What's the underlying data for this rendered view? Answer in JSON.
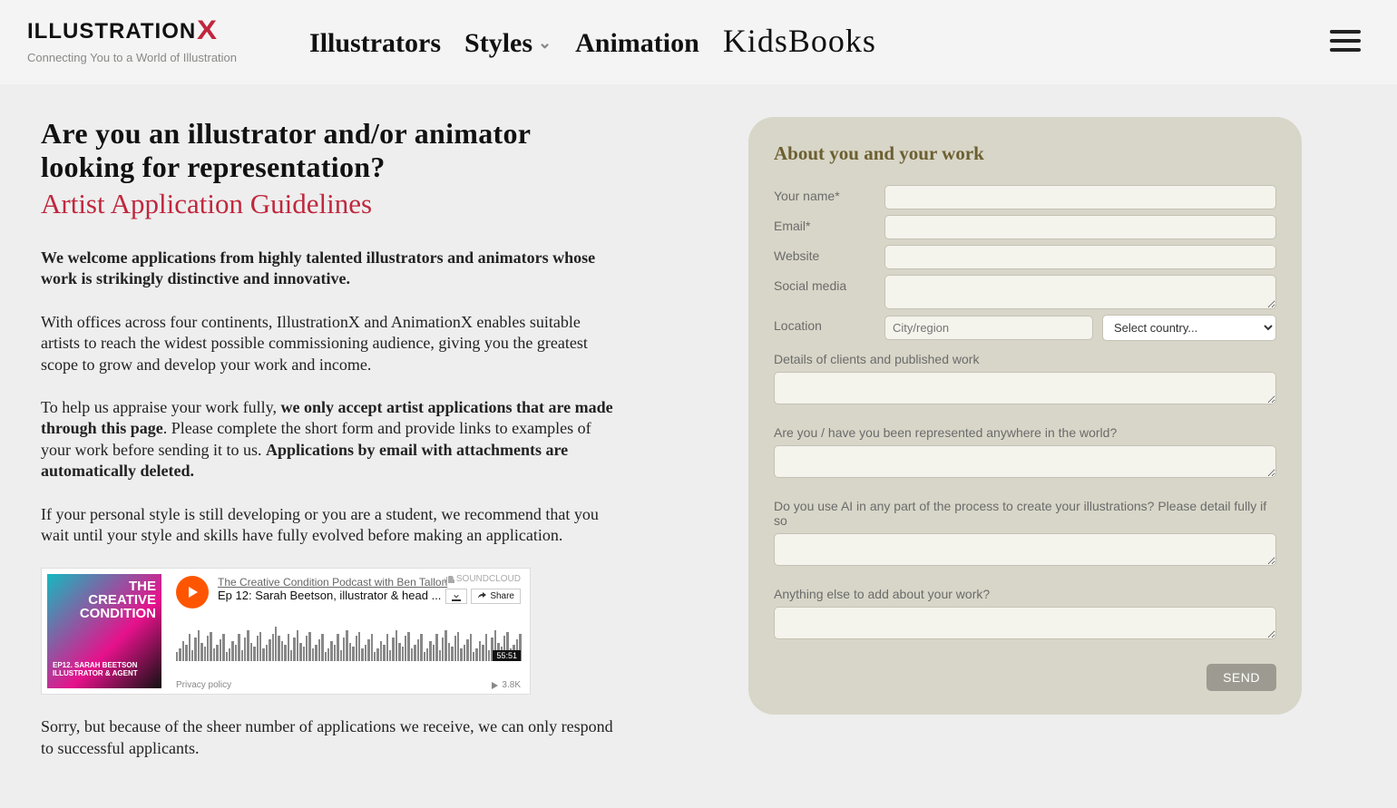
{
  "brand": {
    "name_part1": "ILLUSTRATION",
    "name_part2": "X",
    "tagline": "Connecting You to a World of Illustration"
  },
  "nav": {
    "illustrators": "Illustrators",
    "styles": "Styles",
    "animation": "Animation",
    "kidsbooks": "KidsBooks"
  },
  "headline": "Are you an illustrator and/or animator looking for representation?",
  "subhead": "Artist Application Guidelines",
  "paras": {
    "p1_bold": "We welcome applications from highly talented illustrators and animators whose work is strikingly distinctive and innovative.",
    "p2": "With offices across four continents, IllustrationX and AnimationX enables suitable artists to reach the widest possible commissioning audience, giving you the greatest scope to grow and develop your work and income.",
    "p3_a": "To help us appraise your work fully, ",
    "p3_b_bold": "we only accept artist applications that are made through this page",
    "p3_c": ". Please complete the short form and provide links to examples of your work before sending it to us. ",
    "p3_d_bold": "Applications by email with attachments are automatically deleted.",
    "p4": "If your personal style is still developing or you are a student, we recommend that you wait until your style and skills have fully evolved before making an application.",
    "p5": "Sorry, but because of the sheer number of applications we receive, we can only respond to successful applicants."
  },
  "soundcloud": {
    "brand": "SOUNDCLOUD",
    "art_title_l1": "THE",
    "art_title_l2": "CREATIVE",
    "art_title_l3": "CONDITION",
    "art_sub": "EP12. SARAH BEETSON ILLUSTRATOR & AGENT",
    "link": "The Creative Condition Podcast with Ben Tallon",
    "title": "Ep 12: Sarah Beetson, illustrator & head ...",
    "share": "Share",
    "time": "55:51",
    "plays": "3.8K",
    "privacy": "Privacy policy"
  },
  "form": {
    "title": "About you and your work",
    "labels": {
      "name": "Your name*",
      "email": "Email*",
      "website": "Website",
      "social": "Social media",
      "location": "Location",
      "city_placeholder": "City/region",
      "country_placeholder": "Select country...",
      "clients": "Details of clients and published work",
      "represented": "Are you / have you been represented anywhere in the world?",
      "ai": "Do you use AI in any part of the process to create your illustrations? Please detail fully if so",
      "anything": "Anything else to add about your work?"
    },
    "send": "SEND"
  }
}
